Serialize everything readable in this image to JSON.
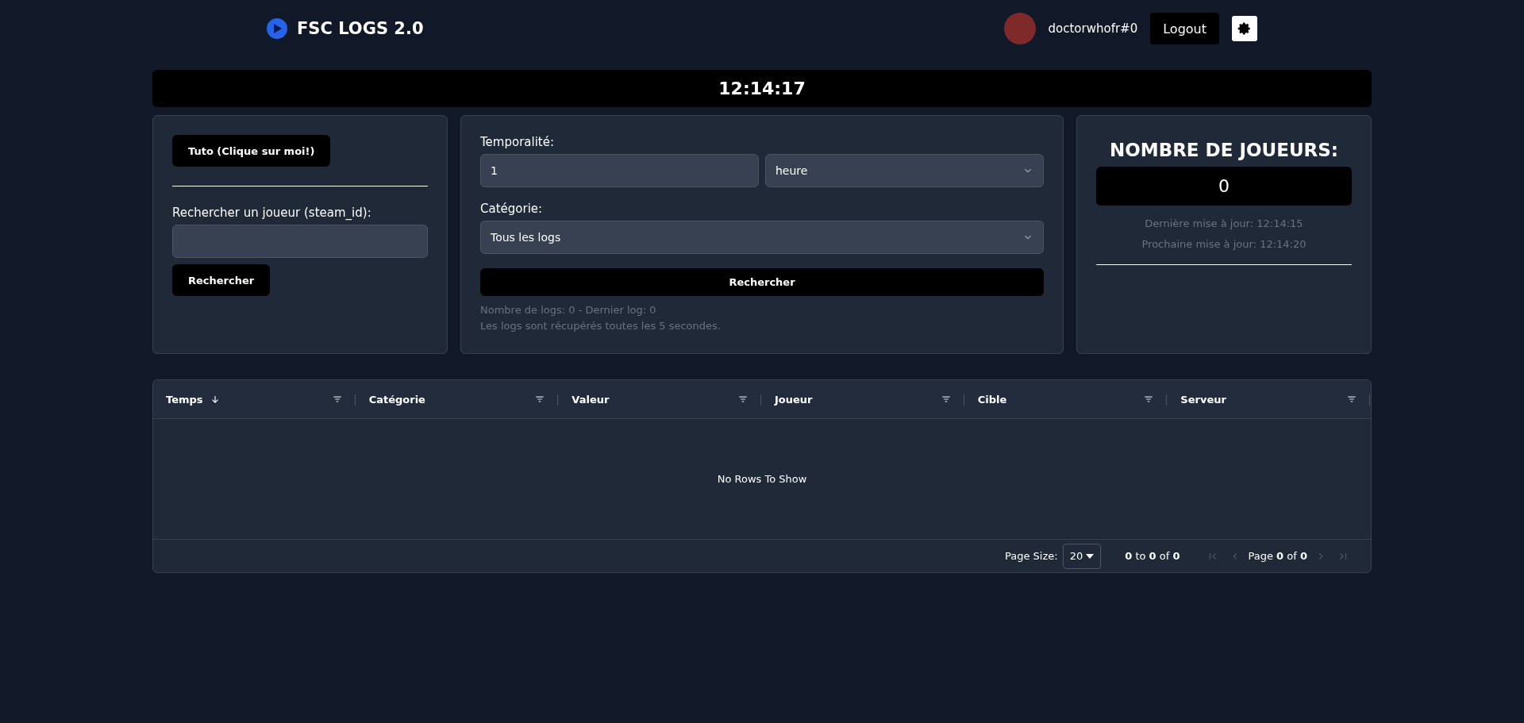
{
  "header": {
    "brand": "FSC LOGS 2.0",
    "username": "doctorwhofr#0",
    "logout": "Logout"
  },
  "clock": "12:14:17",
  "search_panel": {
    "tuto_button": "Tuto (Clique sur moi!)",
    "label": "Rechercher un joueur (steam_id):",
    "button": "Rechercher"
  },
  "filter_panel": {
    "time_label": "Temporalité:",
    "time_value": "1",
    "unit": "heure",
    "category_label": "Catégorie:",
    "category": "Tous les logs",
    "button": "Rechercher",
    "info": [
      "Nombre de logs: 0 - Dernier log: 0",
      "Les logs sont récupérés toutes les 5 secondes."
    ]
  },
  "players_panel": {
    "title": "NOMBRE DE JOUEURS:",
    "count": "0",
    "last_update": "Dernière mise à jour: 12:14:15",
    "next_update": "Prochaine mise à jour: 12:14:20"
  },
  "table": {
    "columns": [
      {
        "label": "Temps",
        "sorted": true
      },
      {
        "label": "Catégorie",
        "sorted": false
      },
      {
        "label": "Valeur",
        "sorted": false
      },
      {
        "label": "Joueur",
        "sorted": false
      },
      {
        "label": "Cible",
        "sorted": false
      },
      {
        "label": "Serveur",
        "sorted": false
      }
    ],
    "empty": "No Rows To Show",
    "pagination": {
      "page_size_label": "Page Size:",
      "page_size": "20",
      "range": "**0** to **0** of **0**",
      "page": "Page **0** of **0**",
      "disabled": true
    }
  }
}
